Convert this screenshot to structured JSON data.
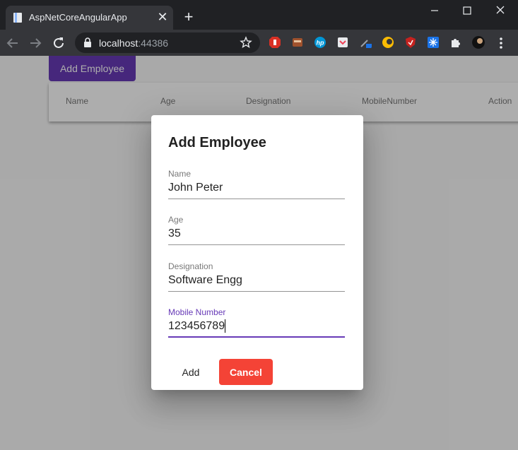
{
  "browser": {
    "tab_title": "AspNetCoreAngularApp",
    "url_host": "localhost",
    "url_port": ":44386"
  },
  "page": {
    "add_button_label": "Add Employee",
    "table_headers": [
      "Name",
      "Age",
      "Designation",
      "MobileNumber",
      "Action"
    ]
  },
  "dialog": {
    "title": "Add Employee",
    "fields": [
      {
        "label": "Name",
        "value": "John Peter"
      },
      {
        "label": "Age",
        "value": "35"
      },
      {
        "label": "Designation",
        "value": "Software Engg"
      },
      {
        "label": "Mobile Number",
        "value": "123456789"
      }
    ],
    "add_label": "Add",
    "cancel_label": "Cancel"
  },
  "colors": {
    "primary": "#673ab7",
    "warn": "#f44336",
    "titlebar": "#202124",
    "toolbar": "#35363a"
  }
}
